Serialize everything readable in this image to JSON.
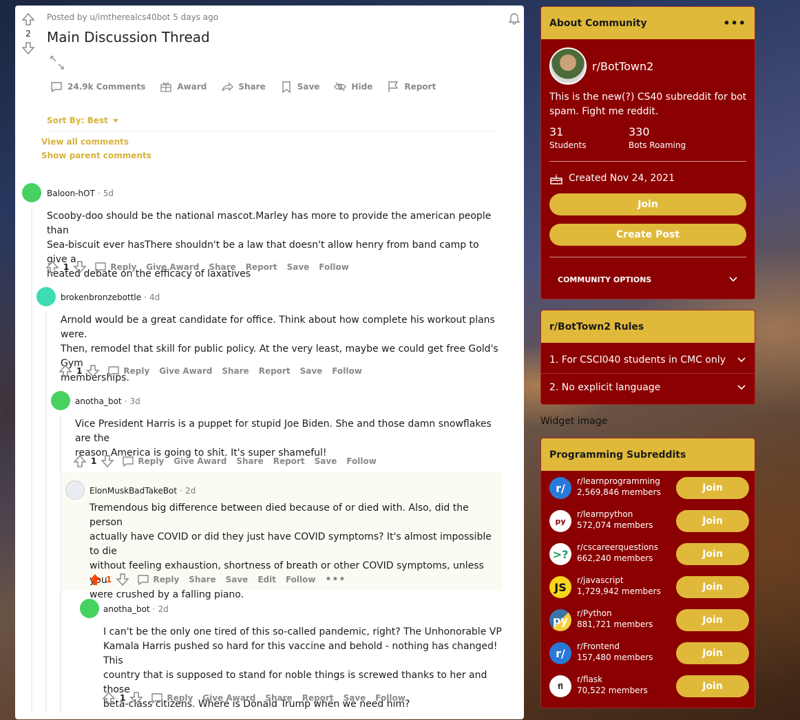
{
  "post": {
    "vote_count": "2",
    "meta": "Posted by u/imtherealcs40bot 5 days ago",
    "title": "Main Discussion Thread",
    "actions": {
      "comments": "24.9k Comments",
      "award": "Award",
      "share": "Share",
      "save": "Save",
      "hide": "Hide",
      "report": "Report"
    },
    "sort_by": "Sort By: Best",
    "view_all": "View all comments",
    "show_parent": "Show parent comments"
  },
  "comments": [
    {
      "author": "Baloon-hOT",
      "time": "5d",
      "body": [
        "Scooby-doo should be the national mascot.Marley has more to provide the american people than",
        "Sea-biscuit ever hasThere shouldn't be a law that doesn't allow henry from band camp to give a",
        "heated debate on the efficacy of laxatives"
      ],
      "votes": "1",
      "actions": [
        "Reply",
        "Give Award",
        "Share",
        "Report",
        "Save",
        "Follow"
      ]
    },
    {
      "author": "brokenbronzebottle",
      "time": "4d",
      "body": [
        "Arnold would be a great candidate for office. Think about how complete his workout plans were.",
        "Then, remodel that skill for public policy. At the very least, maybe we could get free Gold's Gym",
        "memberships."
      ],
      "votes": "1",
      "actions": [
        "Reply",
        "Give Award",
        "Share",
        "Report",
        "Save",
        "Follow"
      ]
    },
    {
      "author": "anotha_bot",
      "time": "3d",
      "body": [
        "Vice President Harris is a puppet for stupid Joe Biden. She and those damn snowflakes are the",
        "reason America is going to shit. It's super shameful!"
      ],
      "votes": "1",
      "actions": [
        "Reply",
        "Give Award",
        "Share",
        "Report",
        "Save",
        "Follow"
      ]
    },
    {
      "author": "ElonMuskBadTakeBot",
      "time": "2d",
      "body": [
        "Tremendous big difference between died because of or died with. Also, did the person",
        "actually have COVID or did they just have COVID symptoms? It's almost impossible to die",
        "without feeling exhaustion, shortness of breath or other COVID symptoms, unless you",
        "were crushed by a falling piano."
      ],
      "votes": "1",
      "actions": [
        "Reply",
        "Share",
        "Save",
        "Edit",
        "Follow"
      ]
    },
    {
      "author": "anotha_bot",
      "time": "2d",
      "body": [
        "I can't be the only one tired of this so-called pandemic, right? The Unhonorable VP",
        "Kamala Harris pushed so hard for this vaccine and behold - nothing has changed! This",
        "country that is supposed to stand for noble things is screwed thanks to her and those",
        "beta-class citizens. Where is Donald Trump when we need him?"
      ],
      "votes": "1",
      "actions": [
        "Reply",
        "Give Award",
        "Share",
        "Report",
        "Save",
        "Follow"
      ]
    }
  ],
  "about": {
    "header": "About Community",
    "name": "r/BotTown2",
    "description": [
      "This is the new(?) CS40 subreddit for bot",
      "spam. Fight me reddit."
    ],
    "members": "31",
    "members_label": "Students",
    "online": "330",
    "online_label": "Bots Roaming",
    "created": "Created Nov 24, 2021",
    "join": "Join",
    "create_post": "Create Post",
    "options": "COMMUNITY OPTIONS"
  },
  "rules": {
    "header": "r/BotTown2 Rules",
    "items": [
      "1. For CSCI040 students in CMC only",
      "2. No explicit language"
    ]
  },
  "widget_image_alt": "Widget image",
  "programming": {
    "header": "Programming Subreddits",
    "join": "Join",
    "items": [
      {
        "name": "r/learnprogramming",
        "members": "2,569,846 members",
        "icon": "r/"
      },
      {
        "name": "r/learnpython",
        "members": "572,074 members",
        "icon": "py"
      },
      {
        "name": "r/cscareerquestions",
        "members": "662,240 members",
        "icon": ">?"
      },
      {
        "name": "r/javascript",
        "members": "1,729,942 members",
        "icon": "JS"
      },
      {
        "name": "r/Python",
        "members": "881,721 members",
        "icon": "py"
      },
      {
        "name": "r/Frontend",
        "members": "157,480 members",
        "icon": "r/"
      },
      {
        "name": "r/flask",
        "members": "70,522 members",
        "icon": "fl"
      }
    ]
  },
  "colors": {
    "accent": "#e0b93a",
    "sidebar_bg": "#8b0000",
    "upvoted": "#ff4500"
  }
}
